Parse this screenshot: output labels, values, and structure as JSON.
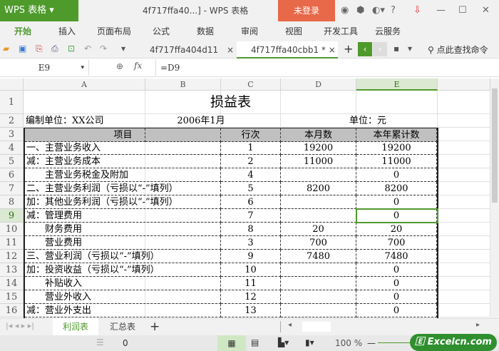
{
  "app": {
    "logo": "WPS 表格",
    "title": "4f717ffa40...] - WPS 表格",
    "login": "未登录",
    "controls": [
      "—",
      "☐",
      "✕"
    ],
    "help": "?"
  },
  "menu": [
    "开始",
    "插入",
    "页面布局",
    "公式",
    "数据",
    "审阅",
    "视图",
    "开发工具",
    "云服务"
  ],
  "tabs": [
    {
      "label": "4f717ffa404d11"
    },
    {
      "label": "4f717ffa40cbb1 *"
    }
  ],
  "search": "点此查找命令",
  "formula_bar": {
    "cell": "E9",
    "fx": "fx",
    "value": "=D9"
  },
  "columns": [
    "A",
    "B",
    "C",
    "D",
    "E"
  ],
  "sheet": {
    "title": "损益表",
    "row2": {
      "a": "编制单位：XX公司",
      "b": "2006年1月",
      "d": "单位：元"
    },
    "header": {
      "item": "项目",
      "line": "行次",
      "month": "本月数",
      "year": "本年累计数"
    },
    "rows": [
      {
        "r": "4",
        "item": "一、主营业务收入",
        "line": "1",
        "month": "19200",
        "year": "19200"
      },
      {
        "r": "5",
        "item": "减：主营业务成本",
        "line": "2",
        "month": "11000",
        "year": "11000"
      },
      {
        "r": "6",
        "item": "　　主营业务税金及附加",
        "line": "4",
        "month": "",
        "year": "0"
      },
      {
        "r": "7",
        "item": "二、主营业务利润（亏损以“-”填列）",
        "line": "5",
        "month": "8200",
        "year": "8200"
      },
      {
        "r": "8",
        "item": "加：其他业务利润（亏损以“-”填列）",
        "line": "6",
        "month": "",
        "year": "0"
      },
      {
        "r": "9",
        "item": "减：管理费用",
        "line": "7",
        "month": "",
        "year": "0"
      },
      {
        "r": "10",
        "item": "　　财务费用",
        "line": "8",
        "month": "20",
        "year": "20"
      },
      {
        "r": "11",
        "item": "　　营业费用",
        "line": "3",
        "month": "700",
        "year": "700"
      },
      {
        "r": "12",
        "item": "三、营业利润（亏损以“-”填列）",
        "line": "9",
        "month": "7480",
        "year": "7480"
      },
      {
        "r": "13",
        "item": "加：投资收益（亏损以“-”填列）",
        "line": "10",
        "month": "",
        "year": "0"
      },
      {
        "r": "14",
        "item": "　　补贴收入",
        "line": "11",
        "month": "",
        "year": "0"
      },
      {
        "r": "15",
        "item": "　　营业外收入",
        "line": "12",
        "month": "",
        "year": "0"
      },
      {
        "r": "16",
        "item": "减：营业外支出",
        "line": "13",
        "month": "",
        "year": "0"
      }
    ]
  },
  "sheet_tabs": [
    "利润表",
    "汇总表"
  ],
  "status": {
    "count": "0",
    "zoom": "100 %",
    "watermark": "Excelcn.com"
  },
  "accent": "#4e9a2b"
}
